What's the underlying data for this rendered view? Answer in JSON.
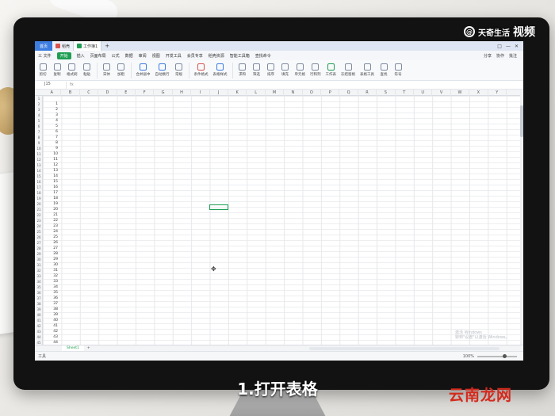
{
  "titlebar": {
    "home_tab": "首页",
    "doc_tab": "稻壳",
    "sheet_tab": "工作簿1",
    "plus": "+",
    "win_controls": [
      "□",
      "—",
      "✕"
    ]
  },
  "menu": {
    "file": "三 文件",
    "start": "开始",
    "items": [
      "插入",
      "页面布局",
      "公式",
      "数据",
      "审阅",
      "视图",
      "开发工具",
      "会员专享",
      "稻壳资源",
      "智能工具箱",
      "查找命令"
    ],
    "right": [
      "分享",
      "协作",
      "批注"
    ]
  },
  "ribbon": {
    "buttons": [
      "剪切",
      "复制",
      "格式刷",
      "粘贴",
      "宋体",
      "加粗",
      "合并居中",
      "自动换行",
      "常规",
      "条件格式",
      "表格样式",
      "求和",
      "筛选",
      "排序",
      "填充",
      "单元格",
      "行和列",
      "工作表",
      "冻结窗格",
      "表格工具",
      "查找",
      "符号"
    ]
  },
  "formula_bar": {
    "name_box": "J15",
    "fx": "fx"
  },
  "columns": [
    "A",
    "B",
    "C",
    "D",
    "E",
    "F",
    "G",
    "H",
    "I",
    "J",
    "K",
    "L",
    "M",
    "N",
    "O",
    "P",
    "Q",
    "R",
    "S",
    "T",
    "U",
    "V",
    "W",
    "X",
    "Y"
  ],
  "row_numbers": [
    "1",
    "2",
    "3",
    "4",
    "5",
    "6",
    "7",
    "8",
    "9",
    "10",
    "11",
    "12",
    "13",
    "14",
    "15",
    "16",
    "17",
    "18",
    "19",
    "20",
    "21",
    "22",
    "23",
    "24",
    "25",
    "26",
    "27",
    "28",
    "29",
    "30",
    "31",
    "32",
    "33",
    "34",
    "35",
    "36",
    "37",
    "38",
    "39",
    "40",
    "41",
    "42",
    "43",
    "44",
    "45"
  ],
  "column_a_values": [
    "1",
    "2",
    "3",
    "4",
    "5",
    "6",
    "7",
    "8",
    "9",
    "10",
    "11",
    "12",
    "13",
    "14",
    "15",
    "16",
    "17",
    "18",
    "19",
    "20",
    "21",
    "22",
    "23",
    "24",
    "25",
    "26",
    "27",
    "28",
    "29",
    "30",
    "31",
    "32",
    "33",
    "34",
    "35",
    "36",
    "37",
    "38",
    "39",
    "40",
    "41",
    "42",
    "43",
    "44"
  ],
  "sheet_tabs": {
    "active": "Sheet1",
    "add": "+"
  },
  "watermark": {
    "line1": "激活 Windows",
    "line2": "转到\"设置\"以激活 Windows。"
  },
  "status": {
    "left": "工具",
    "zoom": "100%"
  },
  "overlay": {
    "brand_logo": "@",
    "brand_name": "天奇生活",
    "brand_suffix": "视频",
    "caption": "1.打开表格",
    "site": "云南龙网"
  },
  "colors": {
    "accent_green": "#1e9e52",
    "accent_blue": "#3d7de0",
    "site_red": "#d42a1d"
  }
}
